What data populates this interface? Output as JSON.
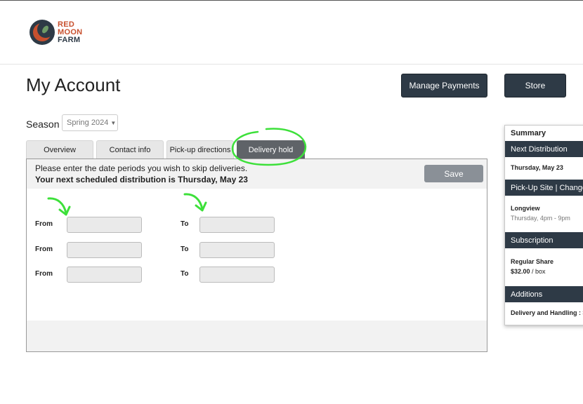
{
  "brand": {
    "line1": "RED",
    "line2": "MOON",
    "line3": "FARM"
  },
  "header": {
    "title": "My Account",
    "manage_payments_label": "Manage Payments",
    "store_label": "Store"
  },
  "season": {
    "label": "Season",
    "selected": "Spring 2024"
  },
  "tabs": [
    {
      "label": "Overview",
      "active": false
    },
    {
      "label": "Contact info",
      "active": false
    },
    {
      "label": "Pick-up directions",
      "active": false
    },
    {
      "label": "Delivery hold",
      "active": true
    }
  ],
  "delivery_hold": {
    "instruction": "Please enter the date periods you wish to skip deliveries.",
    "next_distribution": "Your next scheduled distribution is Thursday, May 23",
    "save_label": "Save",
    "rows": [
      {
        "from_label": "From",
        "to_label": "To",
        "from_value": "",
        "to_value": ""
      },
      {
        "from_label": "From",
        "to_label": "To",
        "from_value": "",
        "to_value": ""
      },
      {
        "from_label": "From",
        "to_label": "To",
        "from_value": "",
        "to_value": ""
      }
    ]
  },
  "summary": {
    "title": "Summary",
    "next_distribution_header": "Next Distribution",
    "next_distribution_date": "Thursday, May 23",
    "pickup_header": "Pick-Up Site | Change",
    "pickup_site": "Longview",
    "pickup_time": "Thursday, 4pm - 9pm",
    "subscription_header": "Subscription",
    "subscription_name": "Regular Share",
    "subscription_price": "$32.00",
    "subscription_unit": "/ box",
    "additions_header": "Additions",
    "additions_item": "Delivery and Handling : $"
  },
  "colors": {
    "navy": "#2e3a46",
    "brand_red": "#c8502e",
    "active_tab": "#5f6368",
    "annotation_green": "#3de03a"
  },
  "icons": [
    "red-moon-farm-logo",
    "caret-down-icon",
    "green-arrow-icon",
    "green-circle-annotation"
  ]
}
